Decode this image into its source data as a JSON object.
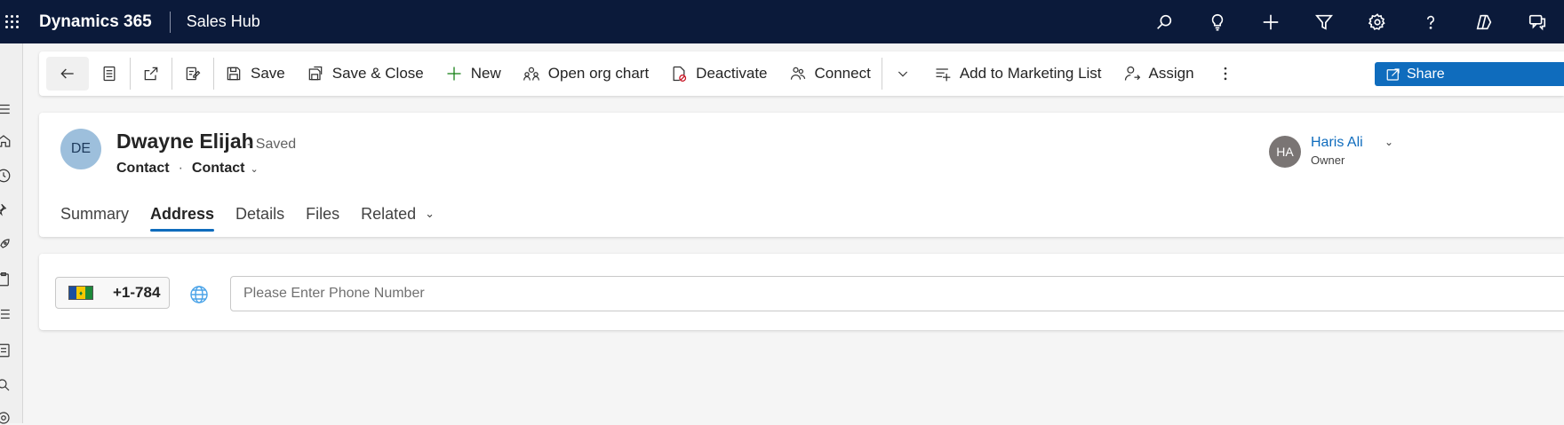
{
  "topbar": {
    "brand": "Dynamics 365",
    "app_name": "Sales Hub",
    "icons": [
      "search-icon",
      "lightbulb-icon",
      "plus-icon",
      "filter-icon",
      "settings-icon",
      "help-icon",
      "copilot-icon",
      "chat-icon"
    ]
  },
  "left_rail": {
    "icons": [
      "menu-icon",
      "home-icon",
      "recent-icon",
      "pin-icon",
      "rocket-icon",
      "clipboard-icon",
      "list-icon",
      "document-icon",
      "search-icon",
      "gear-icon"
    ]
  },
  "command_bar": {
    "save": "Save",
    "save_close": "Save & Close",
    "new": "New",
    "org_chart": "Open org chart",
    "deactivate": "Deactivate",
    "connect": "Connect",
    "add_marketing": "Add to Marketing List",
    "assign": "Assign",
    "share": "Share"
  },
  "record": {
    "initials": "DE",
    "name": "Dwayne Elijah",
    "status": "- Saved",
    "entity": "Contact",
    "form": "Contact",
    "owner": {
      "initials": "HA",
      "name": "Haris Ali",
      "role": "Owner"
    }
  },
  "tabs": [
    {
      "label": "Summary"
    },
    {
      "label": "Address"
    },
    {
      "label": "Details"
    },
    {
      "label": "Files"
    },
    {
      "label": "Related"
    }
  ],
  "active_tab": "Address",
  "phone": {
    "dial_code": "+1-784",
    "placeholder": "Please Enter Phone Number",
    "value": ""
  },
  "colors": {
    "topbar": "#0b1a3a",
    "accent": "#0f6cbd"
  }
}
